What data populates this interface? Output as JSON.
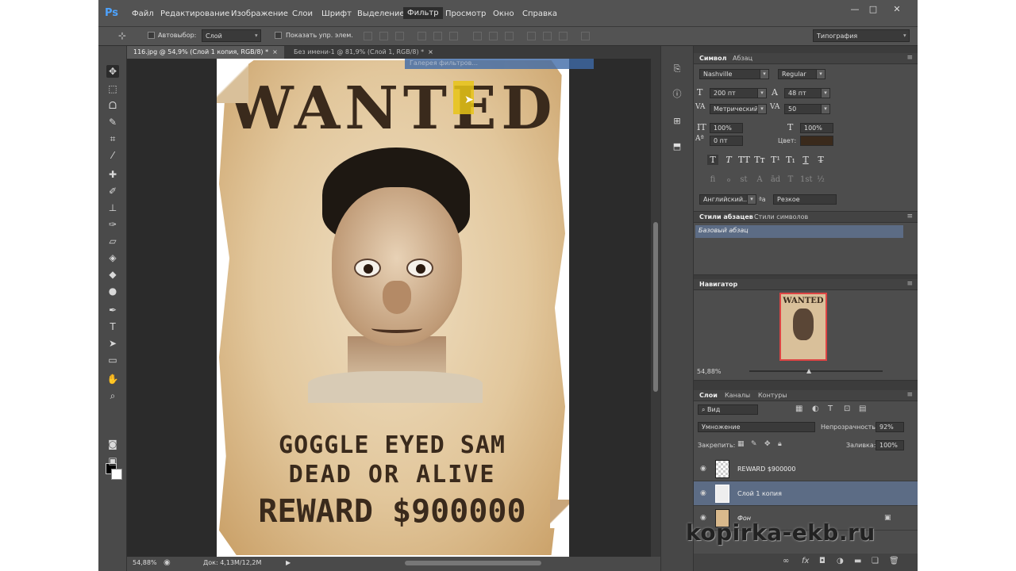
{
  "app": {
    "logo": "Ps"
  },
  "menu": [
    "Файл",
    "Редактирование",
    "Изображение",
    "Слои",
    "Шрифт",
    "Выделение",
    "Фильтр",
    "Просмотр",
    "Окно",
    "Справка"
  ],
  "window_controls": {
    "minimize": "—",
    "restore": "□",
    "close": "✕"
  },
  "options": {
    "autoselect_label": "Автовыбор:",
    "autoselect_value": "Слой",
    "show_transform_label": "Показать упр. элем.",
    "workspace": "Типография"
  },
  "tabs": [
    {
      "label": "116.jpg @ 54,9% (Слой 1 копия, RGB/8) *",
      "close": "×"
    },
    {
      "label": "Без имени-1 @ 81,9% (Слой 1, RGB/8) *",
      "close": "×"
    }
  ],
  "tooltip_text": "Галерея фильтров...",
  "poster": {
    "title": "WANTED",
    "line1": "GOGGLE EYED SAM",
    "line2": "DEAD OR ALIVE",
    "line3": "REWARD $900000"
  },
  "status": {
    "zoom": "54,88%",
    "doc": "Док: 4,13M/12,2M"
  },
  "character_panel": {
    "tabs": [
      "Символ",
      "Абзац"
    ],
    "font_family": "Nashville",
    "font_style": "Regular",
    "size": "200 пт",
    "leading": "48 пт",
    "kerning": "Метрический",
    "tracking": "50",
    "vscale": "100%",
    "hscale": "100%",
    "baseline": "0 пт",
    "color_label": "Цвет:",
    "color": "#3a2a1c",
    "type_styles": [
      "T",
      "T",
      "TT",
      "Tт",
      "T¹",
      "T₁",
      "T",
      "T̶"
    ],
    "opentype": [
      "fi",
      "ℴ",
      "st",
      "A",
      "ād",
      "T",
      "1st",
      "½"
    ],
    "language": "Английский...",
    "aa_label": "ªa",
    "antialias": "Резкое"
  },
  "styles_panel": {
    "tabs": [
      "Стили абзацев",
      "Стили символов"
    ],
    "items": [
      "Базовый абзац"
    ]
  },
  "navigator": {
    "title": "Навигатор",
    "zoom": "54,88%",
    "thumb_title": "WANTED"
  },
  "layers_panel": {
    "tabs": [
      "Слои",
      "Каналы",
      "Контуры"
    ],
    "filter": "Вид",
    "blend_mode": "Умножение",
    "opacity_label": "Непрозрачность:",
    "opacity": "92%",
    "lock_label": "Закрепить:",
    "fill_label": "Заливка:",
    "fill": "100%",
    "layers": [
      {
        "name": "REWARD $900000",
        "selected": false
      },
      {
        "name": "Слой 1 копия",
        "selected": true
      },
      {
        "name": "Фон",
        "selected": false
      }
    ],
    "bottom_icons": [
      "link-icon",
      "fx-icon",
      "mask-icon",
      "adjustment-icon",
      "folder-icon",
      "new-layer-icon",
      "trash-icon"
    ]
  },
  "watermark": "kopirka-ekb.ru"
}
